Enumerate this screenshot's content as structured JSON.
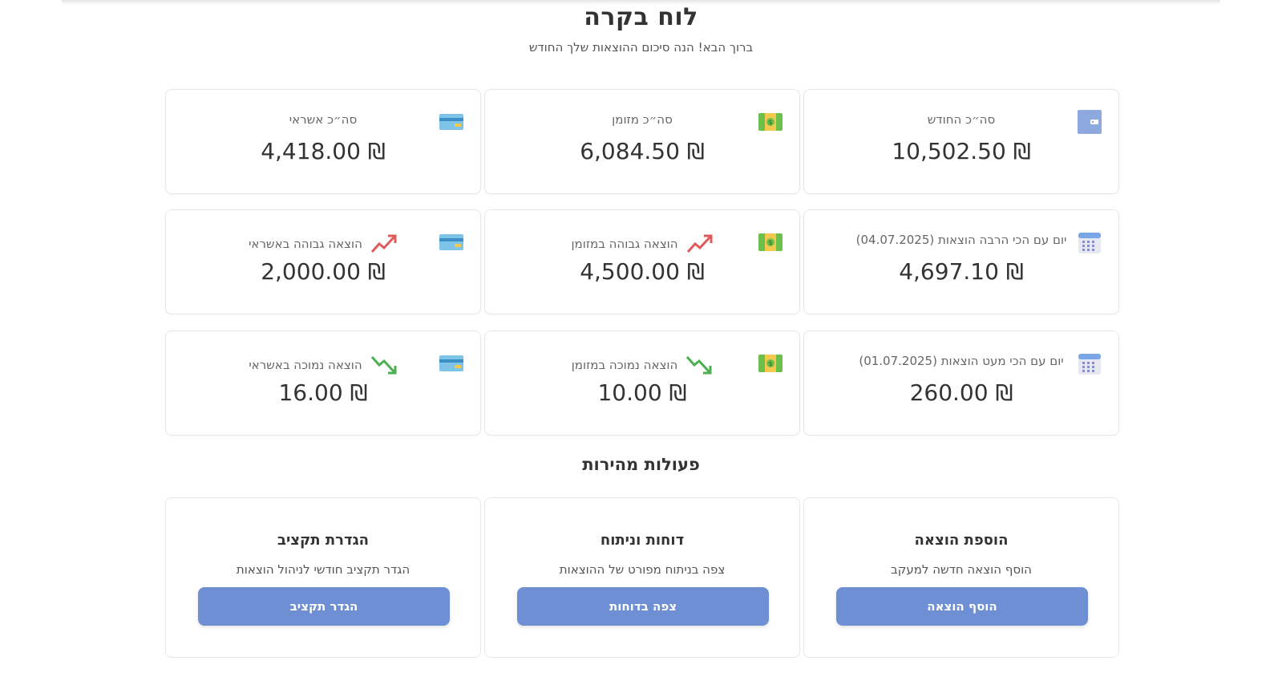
{
  "header": {
    "title": "לוח בקרה",
    "subtitle": "ברוך הבא! הנה סיכום ההוצאות שלך החודש"
  },
  "colors": {
    "accent": "#6f8fd4",
    "card_border": "#e7e7e7",
    "trend_up": "#e05a5a",
    "trend_down": "#4caf50"
  },
  "stats": {
    "month_total": {
      "label": "סה״כ החודש",
      "value": "₪ 10,502.50",
      "icon": "wallet-icon"
    },
    "cash_total": {
      "label": "סה״כ מזומן",
      "value": "₪ 6,084.50",
      "icon": "cash-icon"
    },
    "credit_total": {
      "label": "סה״כ אשראי",
      "value": "₪ 4,418.00",
      "icon": "credit-card-icon"
    },
    "max_day": {
      "label": "יום עם הכי הרבה הוצאות (04.07.2025)",
      "value": "₪ 4,697.10",
      "icon": "calendar-icon"
    },
    "max_cash": {
      "label": "הוצאה גבוהה במזומן",
      "value": "₪ 4,500.00",
      "icon": "cash-icon",
      "trend": "trend-up-icon"
    },
    "max_credit": {
      "label": "הוצאה גבוהה באשראי",
      "value": "₪ 2,000.00",
      "icon": "credit-card-icon",
      "trend": "trend-up-icon"
    },
    "min_day": {
      "label": "יום עם הכי מעט הוצאות (01.07.2025)",
      "value": "₪ 260.00",
      "icon": "calendar-icon"
    },
    "min_cash": {
      "label": "הוצאה נמוכה במזומן",
      "value": "₪ 10.00",
      "icon": "cash-icon",
      "trend": "trend-down-icon"
    },
    "min_credit": {
      "label": "הוצאה נמוכה באשראי",
      "value": "₪ 16.00",
      "icon": "credit-card-icon",
      "trend": "trend-down-icon"
    }
  },
  "quick_actions": {
    "title": "פעולות מהירות",
    "add_expense": {
      "title": "הוספת הוצאה",
      "description": "הוסף הוצאה חדשה למעקב",
      "button": "הוסף הוצאה"
    },
    "reports": {
      "title": "דוחות וניתוח",
      "description": "צפה בניתוח מפורט של ההוצאות",
      "button": "צפה בדוחות"
    },
    "budget": {
      "title": "הגדרת תקציב",
      "description": "הגדר תקציב חודשי לניהול הוצאות",
      "button": "הגדר תקציב"
    }
  }
}
